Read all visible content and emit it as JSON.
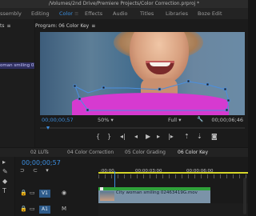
{
  "window": {
    "title": "/Volumes/2nd Drive/Premiere Projects/Color Correction.prproj *"
  },
  "workspaces": [
    {
      "label": "ssembly",
      "active": false
    },
    {
      "label": "Editing",
      "active": false
    },
    {
      "label": "Color",
      "active": true
    },
    {
      "label": "Effects",
      "active": false
    },
    {
      "label": "Audio",
      "active": false
    },
    {
      "label": "Titles",
      "active": false
    },
    {
      "label": "Libraries",
      "active": false
    },
    {
      "label": "Boze Edit",
      "active": false
    }
  ],
  "left_panel": {
    "tab": "ts",
    "clip_label": "oman smiling 02"
  },
  "program": {
    "header": "Program: 06 Color Key",
    "timecode_left": "00;00;00;57",
    "fit": "50%",
    "quality": "Full",
    "timecode_right": "00;00;06;46"
  },
  "bottom_tabs": [
    {
      "label": "02 LUTs",
      "active": false
    },
    {
      "label": "04 Color Correction",
      "active": false
    },
    {
      "label": "05 Color Grading",
      "active": false
    },
    {
      "label": "06 Color Key",
      "active": true
    }
  ],
  "timeline": {
    "timecode": "00;00;00;57",
    "ruler_labels": [
      ":00;00",
      "00;00;03;00",
      "00;00;06;00"
    ],
    "tracks": [
      {
        "label": "V1"
      },
      {
        "label": "A1"
      }
    ],
    "clip": {
      "name": "City woman smiling 02463419G.mov"
    }
  },
  "colors": {
    "accent": "#3b8ee0",
    "clip_green": "#2fa23a",
    "shirt_magenta": "#d63ad0"
  },
  "icons": [
    "menu-icon",
    "wrench-icon",
    "play-icon",
    "step-back-icon",
    "step-forward-icon",
    "mark-in-icon",
    "mark-out-icon",
    "camera-icon",
    "lock-icon",
    "eye-icon",
    "razor-icon",
    "pen-icon",
    "text-icon"
  ]
}
